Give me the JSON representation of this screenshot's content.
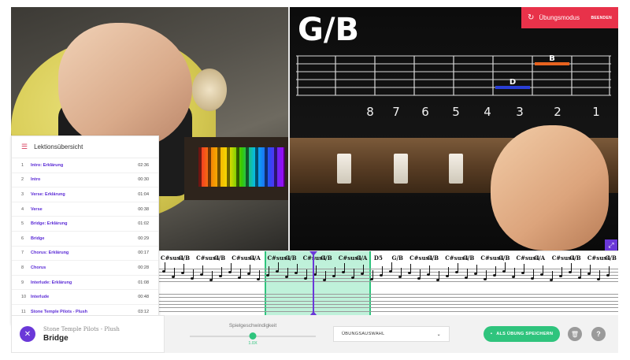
{
  "video": {
    "chord": "G/B",
    "fret_numbers": [
      "8",
      "7",
      "6",
      "5",
      "4",
      "3",
      "2",
      "1"
    ],
    "diagram_notes": [
      {
        "label": "B",
        "color": "#e8631f"
      },
      {
        "label": "D",
        "color": "#2a3fd6"
      }
    ]
  },
  "mode_bar": {
    "label": "Übungsmodus",
    "end_label": "BEENDEN",
    "color": "#e8324a"
  },
  "lessons": {
    "title": "Lektionsübersicht",
    "items": [
      {
        "num": "1",
        "title": "Intro: Erklärung",
        "dur": "02:36"
      },
      {
        "num": "2",
        "title": "Intro",
        "dur": "00:30"
      },
      {
        "num": "3",
        "title": "Verse: Erklärung",
        "dur": "01:04"
      },
      {
        "num": "4",
        "title": "Verse",
        "dur": "00:38"
      },
      {
        "num": "5",
        "title": "Bridge: Erklärung",
        "dur": "01:02"
      },
      {
        "num": "6",
        "title": "Bridge",
        "dur": "00:29"
      },
      {
        "num": "7",
        "title": "Chorus: Erklärung",
        "dur": "00:17"
      },
      {
        "num": "8",
        "title": "Chorus",
        "dur": "00:28"
      },
      {
        "num": "9",
        "title": "Interlude: Erklärung",
        "dur": "01:08"
      },
      {
        "num": "10",
        "title": "Interlude",
        "dur": "00:48"
      },
      {
        "num": "11",
        "title": "Stone Temple Pilots - Plush",
        "dur": "03:12"
      }
    ]
  },
  "notation": {
    "chords": [
      "C#sus4",
      "G/B",
      "C#sus4",
      "G/B",
      "C#sus4",
      "G/A",
      "C#sus4",
      "G/B",
      "C#sus4",
      "G/B",
      "C#sus4",
      "G/A",
      "D5",
      "G/B",
      "C#sus4",
      "G/B",
      "C#sus4",
      "G/B",
      "C#sus4",
      "G/B",
      "C#sus4",
      "G/A",
      "C#sus4",
      "G/B",
      "C#sus4",
      "G/B"
    ]
  },
  "now_playing": {
    "song": "Stone Temple Pilots - Plush",
    "part": "Bridge"
  },
  "speed": {
    "label": "Spielgeschwindigkeit",
    "value": "1.0X",
    "fraction": 0.5
  },
  "controls": {
    "exercise_select": "ÜBUNGSAUSWAHL",
    "save_label": "ALS ÜBUNG SPEICHERN"
  },
  "colors": {
    "accent": "#6a38d8",
    "green": "#2fc47d",
    "red": "#e8324a"
  }
}
